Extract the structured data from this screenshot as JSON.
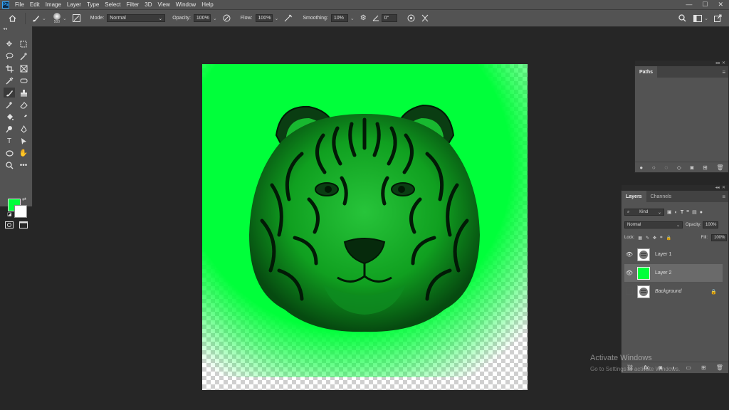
{
  "app": {
    "logo": "Ps"
  },
  "menu": {
    "items": [
      "File",
      "Edit",
      "Image",
      "Layer",
      "Type",
      "Select",
      "Filter",
      "3D",
      "View",
      "Window",
      "Help"
    ]
  },
  "window_controls": {
    "minimize": "—",
    "maximize": "☐",
    "close": "✕"
  },
  "options_bar": {
    "brush_size": "500",
    "mode_label": "Mode:",
    "mode_value": "Normal",
    "opacity_label": "Opacity:",
    "opacity_value": "100%",
    "flow_label": "Flow:",
    "flow_value": "100%",
    "smoothing_label": "Smoothing:",
    "smoothing_value": "10%",
    "angle_value": "0°"
  },
  "colors": {
    "foreground": "#00ff3a",
    "background": "#ffffff",
    "accent": "#31a8ff"
  },
  "paths_panel": {
    "tab_label": "Paths",
    "collapse": "◂◂",
    "close": "✕"
  },
  "layers_panel": {
    "collapse": "◂◂",
    "close": "✕",
    "tabs": [
      "Layers",
      "Channels"
    ],
    "filter_kind": "Kind",
    "blend_mode": "Normal",
    "opacity_label": "Opacity:",
    "opacity_value": "100%",
    "lock_label": "Lock:",
    "fill_label": "Fill:",
    "fill_value": "100%",
    "layers": [
      {
        "name": "Layer 1",
        "visible": true,
        "selected": false
      },
      {
        "name": "Layer 2",
        "visible": true,
        "selected": true
      },
      {
        "name": "Background",
        "visible": false,
        "selected": false,
        "locked": true
      }
    ]
  },
  "watermark": {
    "line1": "Activate Windows",
    "line2": "Go to Settings to activate Windows."
  }
}
